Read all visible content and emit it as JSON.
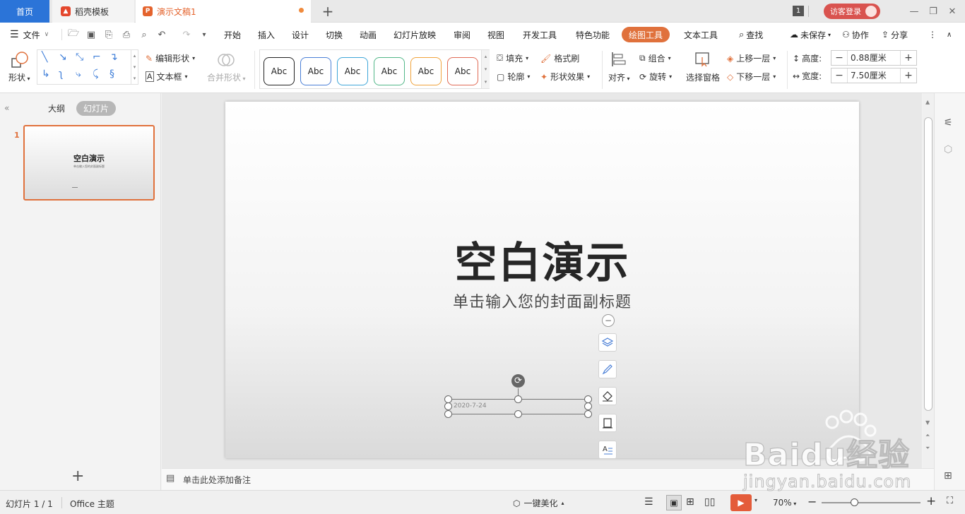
{
  "tabs": {
    "home": "首页",
    "template": "稻壳模板",
    "document": "演示文稿1",
    "window_count": "1",
    "login": "访客登录"
  },
  "menu": {
    "file": "文件",
    "items": [
      "开始",
      "插入",
      "设计",
      "切换",
      "动画",
      "幻灯片放映",
      "审阅",
      "视图",
      "开发工具",
      "特色功能",
      "绘图工具",
      "文本工具"
    ],
    "search": "查找",
    "unsaved": "未保存",
    "collab": "协作",
    "share": "分享"
  },
  "ribbon": {
    "shape": "形状",
    "edit_shape": "编辑形状",
    "textbox": "文本框",
    "merge_shape": "合并形状",
    "style_sample": "Abc",
    "style_colors": [
      "#222222",
      "#4a7fd6",
      "#3fa6d8",
      "#52b788",
      "#f0a33c",
      "#e06a55"
    ],
    "fill": "填充",
    "format_painter": "格式刷",
    "outline": "轮廓",
    "shape_effect": "形状效果",
    "align": "对齐",
    "group": "组合",
    "rotate": "旋转",
    "selection_pane": "选择窗格",
    "bring_forward": "上移一层",
    "send_backward": "下移一层",
    "height_label": "高度:",
    "height_value": "0.88厘米",
    "width_label": "宽度:",
    "width_value": "7.50厘米"
  },
  "leftpanel": {
    "outline_tab": "大纲",
    "slides_tab": "幻灯片",
    "slide_number": "1",
    "thumb_title": "空白演示",
    "thumb_sub": "单击输入您的封面副标题"
  },
  "slide": {
    "title": "空白演示",
    "subtitle": "单击输入您的封面副标题",
    "date": "2020-7-24"
  },
  "notes": {
    "placeholder": "单击此处添加备注"
  },
  "status": {
    "slide_count": "幻灯片 1 / 1",
    "theme": "Office 主题",
    "beautify": "一键美化",
    "zoom": "70%"
  },
  "watermark": {
    "brand": "Baidu经验",
    "url": "jingyan.baidu.com"
  }
}
